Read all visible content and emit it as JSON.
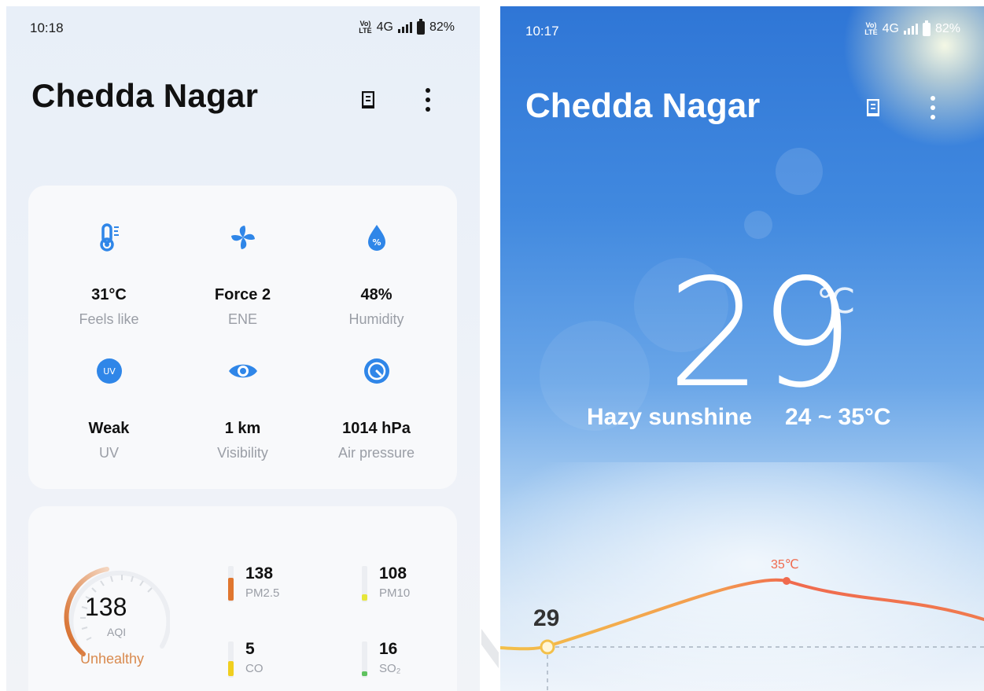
{
  "left": {
    "status": {
      "time": "10:18",
      "network": "4G",
      "battery": "82%"
    },
    "city": "Chedda Nagar",
    "details": [
      {
        "icon": "thermometer-icon",
        "value": "31°C",
        "label": "Feels like"
      },
      {
        "icon": "wind-fan-icon",
        "value": "Force 2",
        "label": "ENE"
      },
      {
        "icon": "humidity-drop-icon",
        "value": "48%",
        "label": "Humidity"
      },
      {
        "icon": "uv-icon",
        "value": "Weak",
        "label": "UV"
      },
      {
        "icon": "eye-icon",
        "value": "1 km",
        "label": "Visibility"
      },
      {
        "icon": "pressure-gauge-icon",
        "value": "1014 hPa",
        "label": "Air pressure"
      }
    ],
    "aqi": {
      "value": "138",
      "label": "AQI",
      "status": "Unhealthy",
      "pollutants": [
        {
          "value": "138",
          "label": "PM2.5",
          "color": "#e0762f",
          "level": 0.7
        },
        {
          "value": "108",
          "label": "PM10",
          "color": "#e6e63a",
          "level": 0.2
        },
        {
          "value": "5",
          "label": "CO",
          "color": "#f0cf1f",
          "level": 0.45
        },
        {
          "value": "16",
          "label": "SO₂",
          "color": "#5fc25f",
          "level": 0.1
        }
      ]
    }
  },
  "right": {
    "status": {
      "time": "10:17",
      "network": "4G",
      "battery": "82%"
    },
    "city": "Chedda Nagar",
    "temperature": "29",
    "unit": "℃",
    "condition": "Hazy sunshine",
    "range": "24 ~ 35°C",
    "chart": {
      "current_label": "29",
      "max_label": "35℃"
    }
  },
  "colors": {
    "accent_blue": "#2f86e8",
    "aqi_orange": "#d98a4e",
    "chart_red": "#f06a4e",
    "chart_yellow": "#f3c04a"
  }
}
